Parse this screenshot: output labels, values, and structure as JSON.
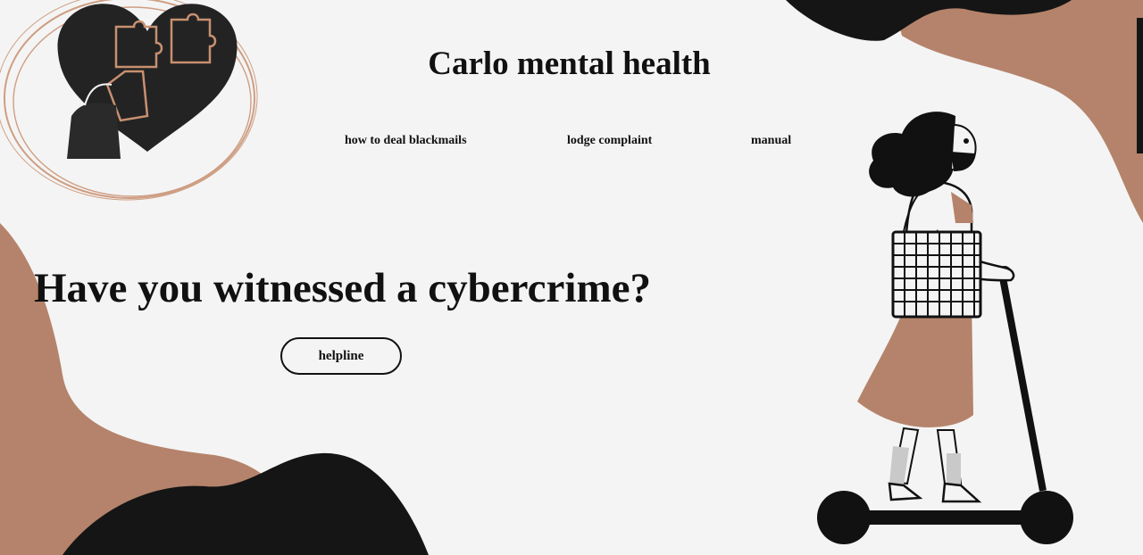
{
  "header": {
    "title": "Carlo mental health",
    "logo_icon": "heart-puzzle-logo-icon"
  },
  "nav": {
    "items": [
      {
        "label": "how to deal blackmails"
      },
      {
        "label": "lodge complaint"
      },
      {
        "label": "manual"
      }
    ]
  },
  "hero": {
    "heading": "Have you witnessed a cybercrime?",
    "button_label": "helpline",
    "illustration": "woman-on-scooter-illustration"
  },
  "colors": {
    "background": "#f4f4f4",
    "accent_tan": "#b5836b",
    "dark": "#151515"
  }
}
